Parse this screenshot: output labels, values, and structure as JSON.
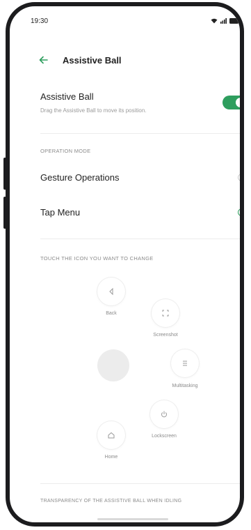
{
  "status_bar": {
    "time": "19:30"
  },
  "header": {
    "title": "Assistive Ball"
  },
  "assistive_ball": {
    "title": "Assistive Ball",
    "subtitle": "Drag the Assistive Ball to move its position.",
    "enabled": true
  },
  "operation_mode": {
    "section_label": "OPERATION MODE",
    "options": [
      {
        "label": "Gesture Operations",
        "selected": false
      },
      {
        "label": "Tap Menu",
        "selected": true
      }
    ]
  },
  "change_icons": {
    "section_label": "TOUCH THE ICON YOU WANT TO CHANGE",
    "icons": [
      {
        "name": "back",
        "label": "Back"
      },
      {
        "name": "screenshot",
        "label": "Screenshot"
      },
      {
        "name": "multitasking",
        "label": "Multitasking"
      },
      {
        "name": "lockscreen",
        "label": "Lockscreen"
      },
      {
        "name": "home",
        "label": "Home"
      }
    ]
  },
  "transparency": {
    "section_label": "TRANSPARENCY OF THE ASSISTIVE BALL WHEN IDLING"
  },
  "colors": {
    "accent": "#2e9e5e",
    "frame": "#1c1c1e"
  }
}
